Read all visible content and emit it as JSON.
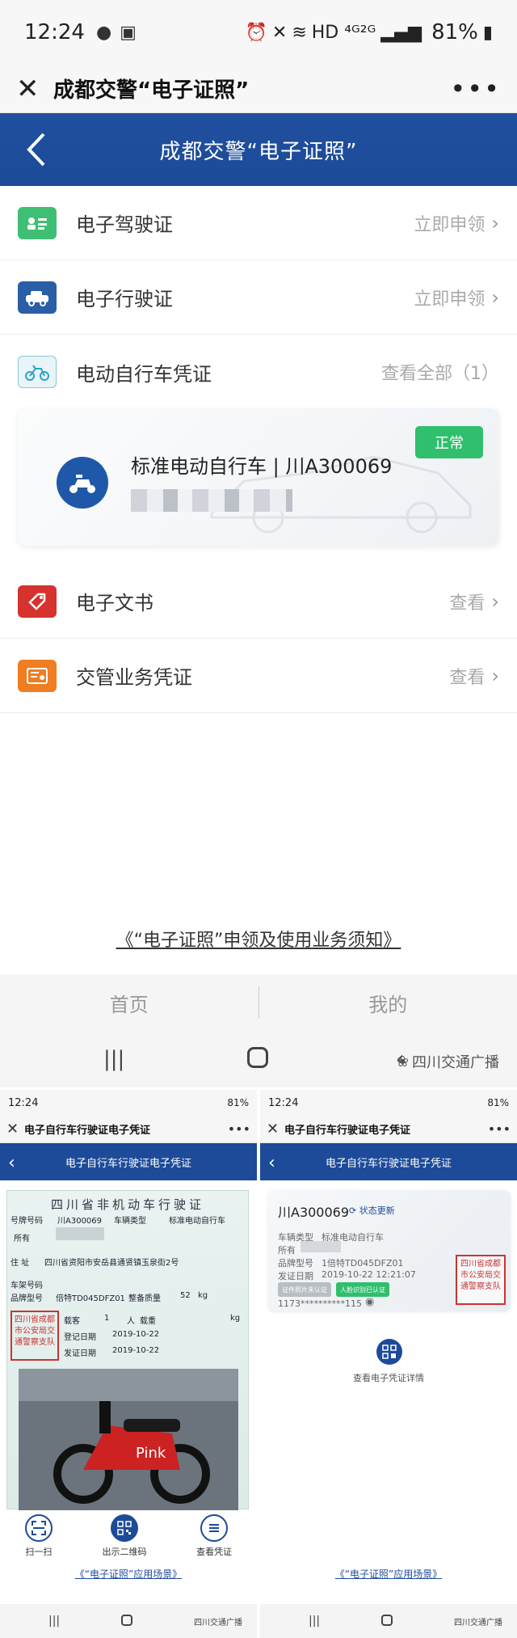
{
  "status_bar": {
    "time": "12:24",
    "network": "HD ⁴ᴳ²ᴳ",
    "battery": "81%"
  },
  "wechat_bar": {
    "title": "成都交警“电子证照”",
    "more": "•••"
  },
  "nav": {
    "title": "成都交警“电子证照”"
  },
  "rows": [
    {
      "label": "电子驾驶证",
      "action": "立即申领"
    },
    {
      "label": "电子行驶证",
      "action": "立即申领"
    },
    {
      "label": "电动自行车凭证",
      "action": "查看全部（1）"
    },
    {
      "label": "电子文书",
      "action": "查看"
    },
    {
      "label": "交管业务凭证",
      "action": "查看"
    }
  ],
  "vehicle_card": {
    "name": "标准电动自行车 | 川A300069",
    "status": "正常"
  },
  "notice_link": "《“电子证照”申领及使用业务须知》",
  "tabs": {
    "home": "首页",
    "mine": "我的"
  },
  "watermark": "四川交通广播",
  "left_panel": {
    "status_time": "12:24",
    "status_battery": "81%",
    "wx_title": "电子自行车行驶证电子凭证",
    "nav_title": "电子自行车行驶证电子凭证",
    "license_title": "四川省非机动车行驶证",
    "fields": {
      "plate_label": "号牌号码",
      "plate": "川A300069",
      "type_label": "车辆类型",
      "type": "标准电动自行车",
      "owner_label": "所有",
      "address_label": "住  址",
      "address": "四川省资阳市安岳县通贤镇玉泉街2号",
      "frame_label": "车架号码",
      "brand_label": "品牌型号",
      "brand": "倍特TD045DFZ01",
      "weight_label": "整备质量",
      "weight": "52",
      "weight_unit": "kg",
      "passenger_label": "载客",
      "passenger": "1",
      "passenger_unit": "人",
      "load_label": "载重",
      "load_unit": "kg",
      "reg_label": "登记日期",
      "reg_date": "2019-10-22",
      "issue_label": "发证日期",
      "issue_date": "2019-10-22"
    },
    "seal": "四川省成都市公安局交通警察支队",
    "tools": [
      {
        "label": "扫一扫"
      },
      {
        "label": "出示二维码"
      },
      {
        "label": "查看凭证"
      }
    ],
    "link": "《“电子证照”应用场景》"
  },
  "right_panel": {
    "status_time": "12:24",
    "status_battery": "81%",
    "wx_title": "电子自行车行驶证电子凭证",
    "nav_title": "电子自行车行驶证电子凭证",
    "plate": "川A300069",
    "update": "状态更新",
    "type_label": "车辆类型",
    "type": "标准电动自行车",
    "owner_label": "所有",
    "brand_label": "品牌型号",
    "brand": "1倍特TD045DFZ01",
    "issue_label": "发证日期",
    "issue": "2019-10-22 12:21:07",
    "btn_gray": "证件照片未认证",
    "btn_green": "人脸识别已认证",
    "id_masked": "1173**********115",
    "seal": "四川省成都市公安局交通警察支队",
    "qr_label": "查看电子凭证详情",
    "link": "《“电子证照”应用场景》"
  },
  "colors": {
    "brand_blue": "#1d4b99",
    "green": "#2fbf6d",
    "seal_red": "#cc3333"
  }
}
